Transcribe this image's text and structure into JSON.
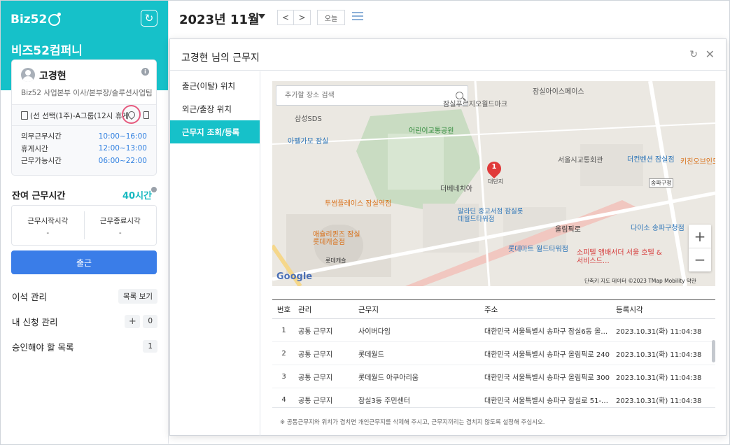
{
  "app": {
    "logo": "Biz52",
    "company": "비즈52컴퍼니"
  },
  "profile": {
    "name": "고경현",
    "description": "Biz52 사업본부 이사/본부장/솔루션사업팀",
    "shift": "(선 선택(1주)-A그룹(12시 휴게",
    "times": [
      {
        "label": "의무근무시간",
        "value": "10:00~16:00"
      },
      {
        "label": "휴게시간",
        "value": "12:00~13:00"
      },
      {
        "label": "근무가능시간",
        "value": "06:00~22:00"
      }
    ]
  },
  "remaining": {
    "label": "잔여 근무시간",
    "value": "40시간"
  },
  "clock": {
    "start_label": "근무시작시각",
    "start_value": "-",
    "end_label": "근무종료시각",
    "end_value": "-"
  },
  "checkin_button": "출근",
  "sidebar_rows": {
    "seat": {
      "label": "이석 관리",
      "action": "목록 보기"
    },
    "requests": {
      "label": "내 신청 관리",
      "plus": "+",
      "count": "0"
    },
    "approvals": {
      "label": "승인해야 할 목록",
      "count": "1"
    }
  },
  "calendar": {
    "title": "2023년 11월",
    "prev": "<",
    "next": ">",
    "today": "오늘"
  },
  "modal": {
    "title": "고경현 님의 근무지",
    "tabs": [
      "출근(이탈) 위치",
      "외근/출장 위치",
      "근무지 조회/등록"
    ],
    "active_tab": 2,
    "search_placeholder": "추가할 장소 검색",
    "map": {
      "labels": [
        "잠실아이스페이스",
        "잠실푸르지오월드마크",
        "삼성SDS",
        "어린이교통공원",
        "아펠가모 잠실",
        "서울시교통회관",
        "더컨벤션 잠실점",
        "키친오브인도 요리",
        "송파구청",
        "더베네치아",
        "대단지",
        "투썸플레이스 잠실역점",
        "알라딘 중고서점 잠실롯데월드타워점",
        "다이소 송파구청점",
        "애슐리퀸즈 잠실 롯데캐슬점",
        "롯데마트 월드타워점",
        "소피텔 앰배서더 서울 호텔 & 서비스드…",
        "올림픽로",
        "롯데캐슬"
      ],
      "marker": "1",
      "footer": "단축키   지도 데이터 ©2023 TMap Mobility   약관",
      "google": "Google",
      "zoom_in": "+",
      "zoom_out": "−"
    },
    "table": {
      "headers": [
        "번호",
        "관리",
        "근무지",
        "주소",
        "등록시각"
      ],
      "rows": [
        [
          "1",
          "공통 근무지",
          "사이버다임",
          "대한민국 서울특별시 송파구 잠실6동 올…",
          "2023.10.31(화) 11:04:38"
        ],
        [
          "2",
          "공통 근무지",
          "롯데월드",
          "대한민국 서울특별시 송파구 올림픽로 240",
          "2023.10.31(화) 11:04:38"
        ],
        [
          "3",
          "공통 근무지",
          "롯데월드 아쿠아리움",
          "대한민국 서울특별시 송파구 올림픽로 300",
          "2023.10.31(화) 11:04:38"
        ],
        [
          "4",
          "공통 근무지",
          "잠실3동 주민센터",
          "대한민국 서울특별시 송파구 잠실로 51-…",
          "2023.10.31(화) 11:04:38"
        ]
      ]
    },
    "note": "※ 공통근무지와 위치가 겹치면 개인근무지를 삭제해 주시고, 근무지끼리는 겹치지 않도록 설정해 주십시오."
  },
  "colors": {
    "brand": "#16c1c9",
    "primary_button": "#3a7de8",
    "time_value": "#2f7fe0",
    "marker": "#e03a3a"
  }
}
